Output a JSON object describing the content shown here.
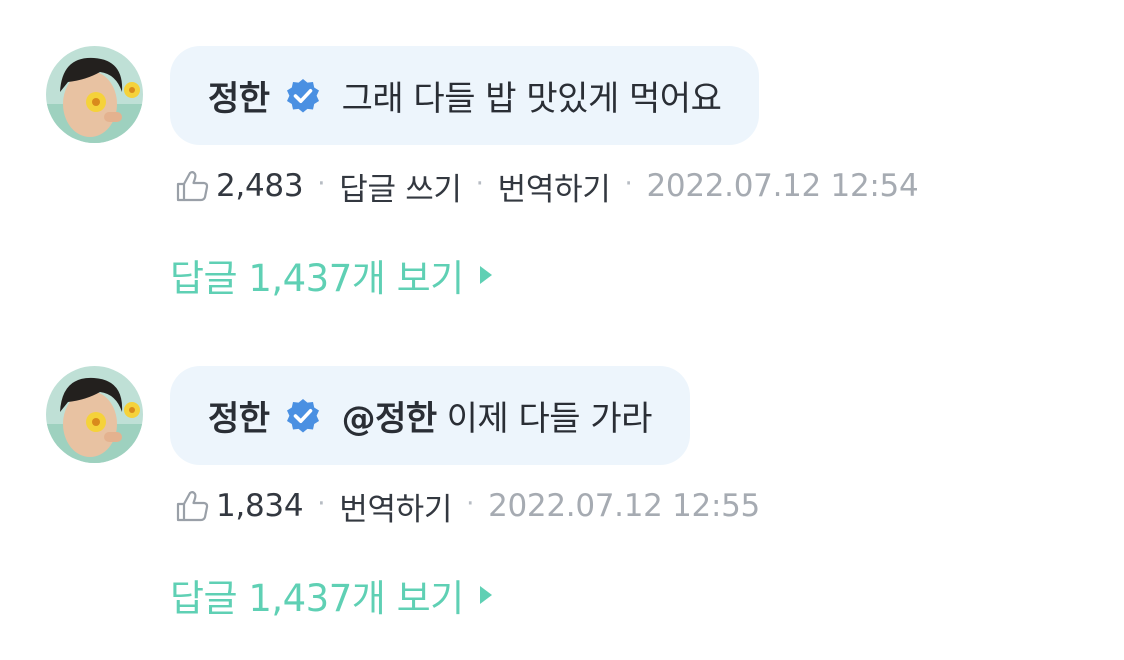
{
  "comments": [
    {
      "author": "정한",
      "verified": true,
      "mention": "",
      "message": "그래 다들 밥 맛있게 먹어요",
      "likes": "2,483",
      "reply_action": "답글 쓰기",
      "translate_action": "번역하기",
      "timestamp": "2022.07.12 12:54",
      "replies_link": "답글 1,437개 보기"
    },
    {
      "author": "정한",
      "verified": true,
      "mention": "@정한",
      "message": "이제 다들 가라",
      "likes": "1,834",
      "translate_action": "번역하기",
      "timestamp": "2022.07.12 12:55",
      "replies_link": "답글 1,437개 보기"
    }
  ],
  "icons": {
    "like": "thumbs-up-outline-icon",
    "verified": "verified-badge-icon",
    "replies_arrow": "triangle-right-icon"
  },
  "colors": {
    "bubble_bg": "#edf5fc",
    "verified": "#4a90e2",
    "accent_mint": "#5fd0b4",
    "timestamp": "#a6abb2"
  }
}
